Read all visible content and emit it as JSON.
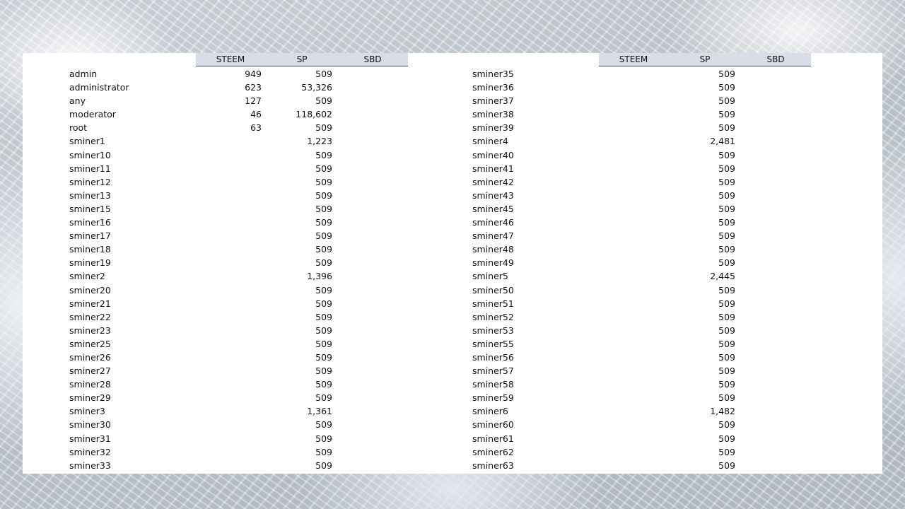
{
  "headers": [
    "STEEM",
    "SP",
    "SBD"
  ],
  "left_rows": [
    {
      "name": "admin",
      "steem": "949",
      "sp": "509"
    },
    {
      "name": "administrator",
      "steem": "623",
      "sp": "53,326"
    },
    {
      "name": "any",
      "steem": "127",
      "sp": "509"
    },
    {
      "name": "moderator",
      "steem": "46",
      "sp": "118,602"
    },
    {
      "name": "root",
      "steem": "63",
      "sp": "509"
    },
    {
      "name": "sminer1",
      "steem": "",
      "sp": "1,223"
    },
    {
      "name": "sminer10",
      "steem": "",
      "sp": "509"
    },
    {
      "name": "sminer11",
      "steem": "",
      "sp": "509"
    },
    {
      "name": "sminer12",
      "steem": "",
      "sp": "509"
    },
    {
      "name": "sminer13",
      "steem": "",
      "sp": "509"
    },
    {
      "name": "sminer15",
      "steem": "",
      "sp": "509"
    },
    {
      "name": "sminer16",
      "steem": "",
      "sp": "509"
    },
    {
      "name": "sminer17",
      "steem": "",
      "sp": "509"
    },
    {
      "name": "sminer18",
      "steem": "",
      "sp": "509"
    },
    {
      "name": "sminer19",
      "steem": "",
      "sp": "509"
    },
    {
      "name": "sminer2",
      "steem": "",
      "sp": "1,396"
    },
    {
      "name": "sminer20",
      "steem": "",
      "sp": "509"
    },
    {
      "name": "sminer21",
      "steem": "",
      "sp": "509"
    },
    {
      "name": "sminer22",
      "steem": "",
      "sp": "509"
    },
    {
      "name": "sminer23",
      "steem": "",
      "sp": "509"
    },
    {
      "name": "sminer25",
      "steem": "",
      "sp": "509"
    },
    {
      "name": "sminer26",
      "steem": "",
      "sp": "509"
    },
    {
      "name": "sminer27",
      "steem": "",
      "sp": "509"
    },
    {
      "name": "sminer28",
      "steem": "",
      "sp": "509"
    },
    {
      "name": "sminer29",
      "steem": "",
      "sp": "509"
    },
    {
      "name": "sminer3",
      "steem": "",
      "sp": "1,361"
    },
    {
      "name": "sminer30",
      "steem": "",
      "sp": "509"
    },
    {
      "name": "sminer31",
      "steem": "",
      "sp": "509"
    },
    {
      "name": "sminer32",
      "steem": "",
      "sp": "509"
    },
    {
      "name": "sminer33",
      "steem": "",
      "sp": "509"
    }
  ],
  "right_rows": [
    {
      "name": "sminer35",
      "steem": "",
      "sp": "509"
    },
    {
      "name": "sminer36",
      "steem": "",
      "sp": "509"
    },
    {
      "name": "sminer37",
      "steem": "",
      "sp": "509"
    },
    {
      "name": "sminer38",
      "steem": "",
      "sp": "509"
    },
    {
      "name": "sminer39",
      "steem": "",
      "sp": "509"
    },
    {
      "name": "sminer4",
      "steem": "",
      "sp": "2,481"
    },
    {
      "name": "sminer40",
      "steem": "",
      "sp": "509"
    },
    {
      "name": "sminer41",
      "steem": "",
      "sp": "509"
    },
    {
      "name": "sminer42",
      "steem": "",
      "sp": "509"
    },
    {
      "name": "sminer43",
      "steem": "",
      "sp": "509"
    },
    {
      "name": "sminer45",
      "steem": "",
      "sp": "509"
    },
    {
      "name": "sminer46",
      "steem": "",
      "sp": "509"
    },
    {
      "name": "sminer47",
      "steem": "",
      "sp": "509"
    },
    {
      "name": "sminer48",
      "steem": "",
      "sp": "509"
    },
    {
      "name": "sminer49",
      "steem": "",
      "sp": "509"
    },
    {
      "name": "sminer5",
      "steem": "",
      "sp": "2,445"
    },
    {
      "name": "sminer50",
      "steem": "",
      "sp": "509"
    },
    {
      "name": "sminer51",
      "steem": "",
      "sp": "509"
    },
    {
      "name": "sminer52",
      "steem": "",
      "sp": "509"
    },
    {
      "name": "sminer53",
      "steem": "",
      "sp": "509"
    },
    {
      "name": "sminer55",
      "steem": "",
      "sp": "509"
    },
    {
      "name": "sminer56",
      "steem": "",
      "sp": "509"
    },
    {
      "name": "sminer57",
      "steem": "",
      "sp": "509"
    },
    {
      "name": "sminer58",
      "steem": "",
      "sp": "509"
    },
    {
      "name": "sminer59",
      "steem": "",
      "sp": "509"
    },
    {
      "name": "sminer6",
      "steem": "",
      "sp": "1,482"
    },
    {
      "name": "sminer60",
      "steem": "",
      "sp": "509"
    },
    {
      "name": "sminer61",
      "steem": "",
      "sp": "509"
    },
    {
      "name": "sminer62",
      "steem": "",
      "sp": "509"
    },
    {
      "name": "sminer63",
      "steem": "",
      "sp": "509"
    }
  ]
}
